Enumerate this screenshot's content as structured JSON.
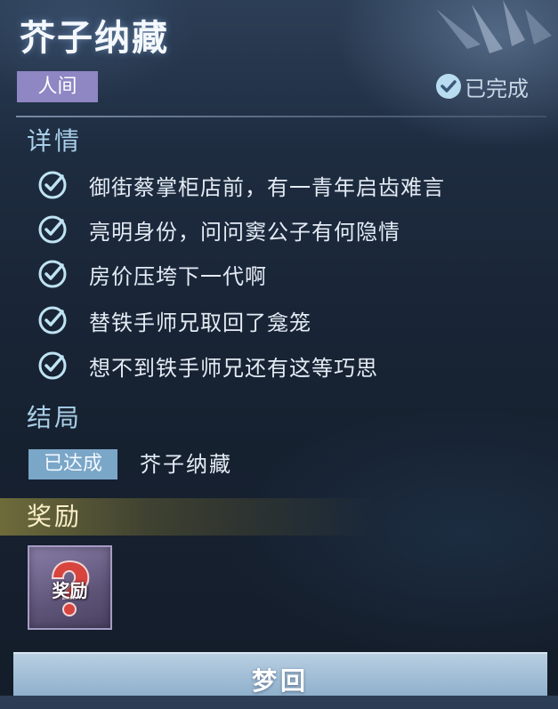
{
  "header": {
    "title": "芥子纳藏",
    "category_tag": "人间",
    "status_text": "已完成",
    "status_icon": "check-circle-icon"
  },
  "details": {
    "heading": "详情",
    "items": [
      {
        "text": "御街蔡掌柜店前，有一青年启齿难言",
        "icon": "check-icon"
      },
      {
        "text": "亮明身份，问问窦公子有何隐情",
        "icon": "check-icon"
      },
      {
        "text": "房价压垮下一代啊",
        "icon": "check-icon"
      },
      {
        "text": "替铁手师兄取回了龛笼",
        "icon": "check-icon"
      },
      {
        "text": "想不到铁手师兄还有这等巧思",
        "icon": "check-icon"
      }
    ]
  },
  "ending": {
    "heading": "结局",
    "badge": "已达成",
    "name": "芥子纳藏"
  },
  "reward": {
    "heading": "奖励",
    "item_label": "奖励",
    "item_icon": "mystery-reward-icon"
  },
  "footer": {
    "button_label": "梦回"
  },
  "colors": {
    "tag_bg": "#8f86c4",
    "check": "#bfe3f3",
    "ending_badge_bg": "#7aa6c8",
    "reward_bar": "#78733c",
    "button_bg": "#a6c2da"
  }
}
